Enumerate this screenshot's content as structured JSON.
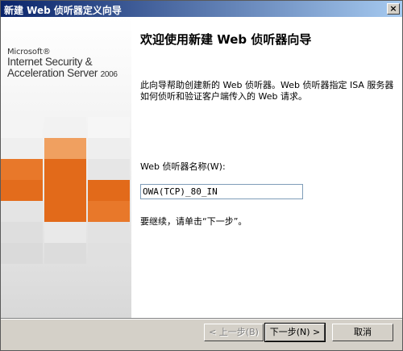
{
  "window": {
    "title": "新建 Web 侦听器定义向导",
    "close_label": "×"
  },
  "branding": {
    "microsoft": "Microsoft®",
    "product_line1": "Internet Security &",
    "product_line2": "Acceleration Server",
    "year": "2006"
  },
  "main": {
    "heading": "欢迎使用新建 Web 侦听器向导",
    "description": "此向导帮助创建新的 Web 侦听器。Web 侦听器指定 ISA 服务器如何侦听和验证客户端传入的 Web 请求。",
    "name_label": "Web 侦听器名称(W):",
    "name_value": "OWA(TCP)_80_IN",
    "continue_text": "要继续，请单击“下一步”。"
  },
  "buttons": {
    "back": "< 上一步(B)",
    "next": "下一步(N) >",
    "cancel": "取消"
  },
  "colors": {
    "title_start": "#0a246a",
    "title_end": "#a6caf0",
    "accent_orange": "#e26a1a",
    "accent_light_orange": "#f0a060"
  }
}
